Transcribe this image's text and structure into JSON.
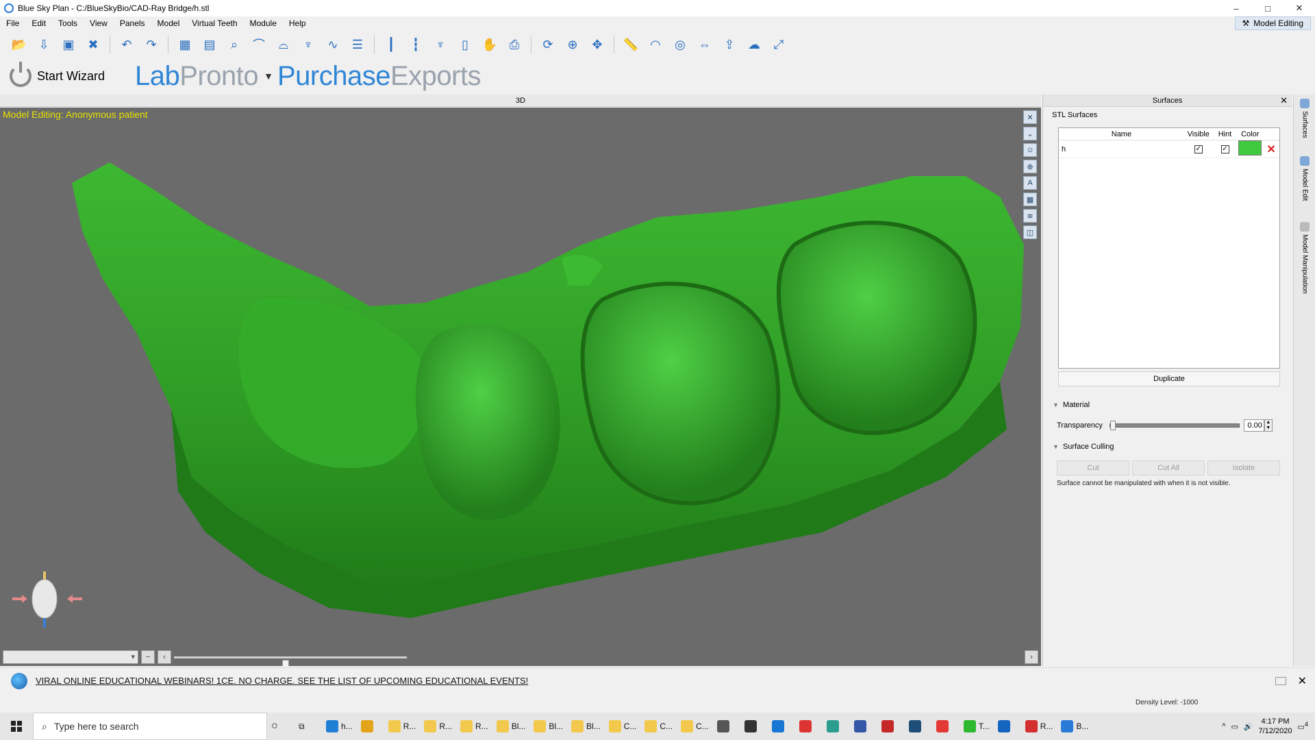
{
  "window": {
    "title": "Blue Sky Plan - C:/BlueSkyBio/CAD-Ray Bridge/h.stl",
    "controls": [
      "–",
      "□",
      "✕"
    ]
  },
  "menu": [
    "File",
    "Edit",
    "Tools",
    "View",
    "Panels",
    "Model",
    "Virtual Teeth",
    "Module",
    "Help"
  ],
  "mode_badge": "Model Editing",
  "toolbar_icons": [
    "open-icon",
    "import-icon",
    "save-icon",
    "close-file-icon",
    "undo-icon",
    "redo-icon",
    "grid-icon",
    "panel-icon",
    "zoom-search-icon",
    "curve-icon",
    "arch-icon",
    "tooth-icon",
    "spline-icon",
    "settings-list-icon",
    "implant-icon",
    "implant-2-icon",
    "tooth-model-icon",
    "implant-3-icon",
    "hands-icon",
    "export-icon",
    "rotate-icon",
    "zoom-icon",
    "pan-icon",
    "ruler-icon",
    "protractor-icon",
    "ring-icon",
    "measure-icon",
    "upload-cloud-icon",
    "cloud-icon",
    "expand-icon"
  ],
  "brand": {
    "start_wizard": "Start Wizard",
    "lab": "Lab",
    "pronto": "Pronto",
    "purchase": "Purchase",
    "exports": "Exports"
  },
  "viewport": {
    "header": "3D",
    "label": "Model Editing: Anonymous patient",
    "slider_value": 0.48
  },
  "surfaces_panel": {
    "title": "Surfaces",
    "section_label": "STL Surfaces",
    "columns": [
      "Name",
      "Visible",
      "Hint",
      "Color"
    ],
    "rows": [
      {
        "name": "h",
        "visible": true,
        "hint": true,
        "color": "#3fc93f"
      }
    ],
    "duplicate_label": "Duplicate",
    "material_title": "Material",
    "transparency_label": "Transparency",
    "transparency_value": "0.00",
    "culling_title": "Surface Culling",
    "cull_buttons": [
      "Cut",
      "Cut All",
      "Isolate"
    ],
    "note": "Surface cannot be manipulated with when it is not visible."
  },
  "side_tabs": [
    "Surfaces",
    "Model Edit",
    "Model Manipulation"
  ],
  "news": {
    "text": "VIRAL ONLINE EDUCATIONAL WEBINARS! 1CE. NO CHARGE. SEE THE LIST OF UPCOMING EDUCATIONAL EVENTS!"
  },
  "status": {
    "density": "Density Level: -1000"
  },
  "taskbar": {
    "search_placeholder": "Type here to search",
    "apps": [
      {
        "label": "h...",
        "color": "#1e7fd4"
      },
      {
        "label": "",
        "color": "#e3a419"
      },
      {
        "label": "R...",
        "color": "#f2c94c"
      },
      {
        "label": "R...",
        "color": "#f2c94c"
      },
      {
        "label": "R...",
        "color": "#f2c94c"
      },
      {
        "label": "Bl...",
        "color": "#f2c94c"
      },
      {
        "label": "Bl...",
        "color": "#f2c94c"
      },
      {
        "label": "Bl...",
        "color": "#f2c94c"
      },
      {
        "label": "C...",
        "color": "#f2c94c"
      },
      {
        "label": "C...",
        "color": "#f2c94c"
      },
      {
        "label": "C...",
        "color": "#f2c94c"
      }
    ],
    "extra_apps": [
      {
        "label": "",
        "color": "#555"
      },
      {
        "label": "",
        "color": "#333"
      },
      {
        "label": "",
        "color": "#1976d2"
      },
      {
        "label": "",
        "color": "#d33"
      },
      {
        "label": "",
        "color": "#2a9d8f"
      },
      {
        "label": "",
        "color": "#3557a8"
      },
      {
        "label": "",
        "color": "#c62828"
      },
      {
        "label": "",
        "color": "#1f4e79"
      },
      {
        "label": "",
        "color": "#e53935"
      },
      {
        "label": "T...",
        "color": "#2eb82e"
      },
      {
        "label": "",
        "color": "#1565c0"
      },
      {
        "label": "R...",
        "color": "#d32f2f"
      },
      {
        "label": "B...",
        "color": "#2a7bd8"
      }
    ],
    "time": "4:17 PM",
    "date": "7/12/2020",
    "notifications": "4"
  }
}
